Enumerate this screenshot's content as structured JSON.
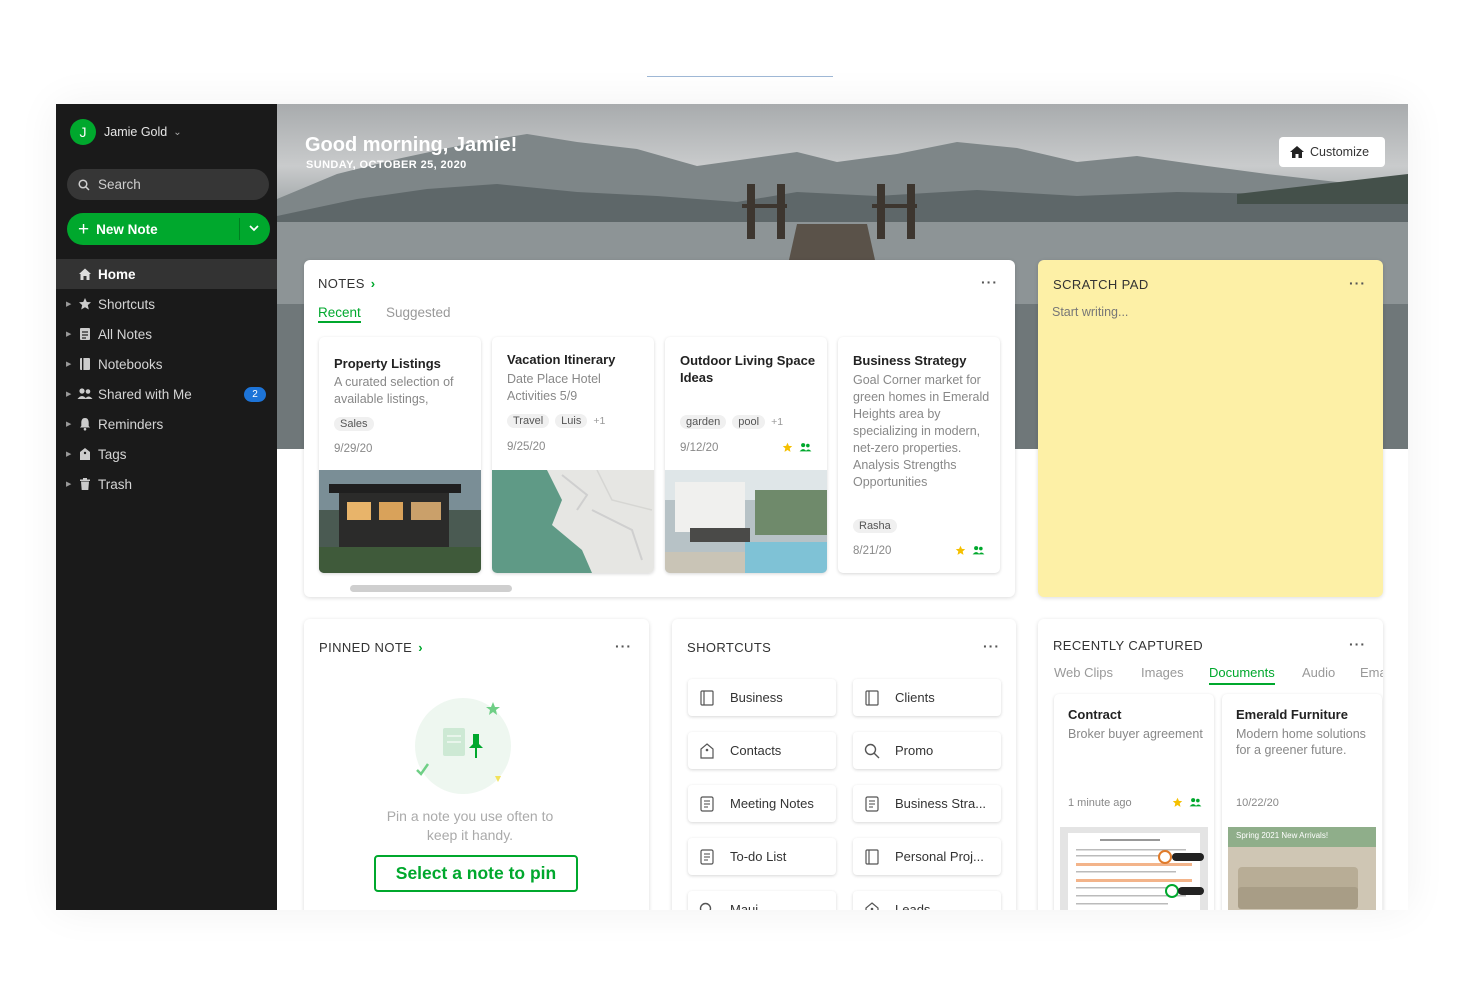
{
  "sidebar": {
    "account": {
      "initial": "J",
      "name": "Jamie Gold"
    },
    "search_label": "Search",
    "new_note_label": "New Note",
    "items": [
      {
        "label": "Home",
        "icon": "home-icon"
      },
      {
        "label": "Shortcuts",
        "icon": "star-icon"
      },
      {
        "label": "All Notes",
        "icon": "notes-icon"
      },
      {
        "label": "Notebooks",
        "icon": "notebook-icon"
      },
      {
        "label": "Shared with Me",
        "icon": "shared-icon",
        "badge": "2"
      },
      {
        "label": "Reminders",
        "icon": "bell-icon"
      },
      {
        "label": "Tags",
        "icon": "tag-icon"
      },
      {
        "label": "Trash",
        "icon": "trash-icon"
      }
    ]
  },
  "hero": {
    "greeting": "Good morning, Jamie!",
    "date": "SUNDAY, OCTOBER 25, 2020",
    "customize_label": "Customize"
  },
  "notes": {
    "title": "NOTES",
    "tabs": [
      "Recent",
      "Suggested"
    ],
    "cards": [
      {
        "title": "Property Listings",
        "body": "A curated selection of available listings,",
        "tags": [
          "Sales"
        ],
        "more": "",
        "date": "9/29/20",
        "image": "house"
      },
      {
        "title": "Vacation Itinerary",
        "body": "Date Place Hotel Activities 5/9",
        "tags": [
          "Travel",
          "Luis"
        ],
        "more": "+1",
        "date": "9/25/20",
        "image": "map"
      },
      {
        "title": "Outdoor Living Space Ideas",
        "body": "",
        "tags": [
          "garden",
          "pool"
        ],
        "more": "+1",
        "date": "9/12/20",
        "image": "pool"
      },
      {
        "title": "Business Strategy",
        "body": "Goal Corner market for green homes in Emerald Heights area by specializing in modern, net-zero properties. Analysis Strengths Opportunities",
        "tags": [
          "Rasha"
        ],
        "more": "",
        "date": "8/21/20",
        "image": ""
      }
    ]
  },
  "scratch": {
    "title": "SCRATCH PAD",
    "placeholder": "Start writing..."
  },
  "pinned": {
    "title": "PINNED NOTE",
    "message": "Pin a note you use often to keep it handy.",
    "button": "Select a note to pin"
  },
  "shortcuts": {
    "title": "SHORTCUTS",
    "items": [
      {
        "label": "Business",
        "icon": "notebook-icon"
      },
      {
        "label": "Clients",
        "icon": "notebook-icon"
      },
      {
        "label": "Contacts",
        "icon": "tag-icon"
      },
      {
        "label": "Promo",
        "icon": "search-icon"
      },
      {
        "label": "Meeting Notes",
        "icon": "note-icon"
      },
      {
        "label": "Business Stra...",
        "icon": "note-icon"
      },
      {
        "label": "To-do List",
        "icon": "note-icon"
      },
      {
        "label": "Personal Proj...",
        "icon": "notebook-icon"
      },
      {
        "label": "Maui",
        "icon": "search-icon"
      },
      {
        "label": "Leads",
        "icon": "tag-icon"
      }
    ]
  },
  "recent": {
    "title": "RECENTLY CAPTURED",
    "tabs": [
      "Web Clips",
      "Images",
      "Documents",
      "Audio",
      "Emai"
    ],
    "active_tab": "Documents",
    "cards": [
      {
        "title": "Contract",
        "body": "Broker buyer agreement",
        "date": "1 minute ago"
      },
      {
        "title": "Emerald Furniture",
        "body": "Modern home solutions for a greener future.",
        "date": "10/22/20",
        "thumb_caption": "Spring 2021 New Arrivals!"
      }
    ]
  },
  "colors": {
    "accent": "#00a82d",
    "sidebar": "#1a1a1a",
    "scratch": "#fdf0a6",
    "badge": "#1d74d8"
  }
}
